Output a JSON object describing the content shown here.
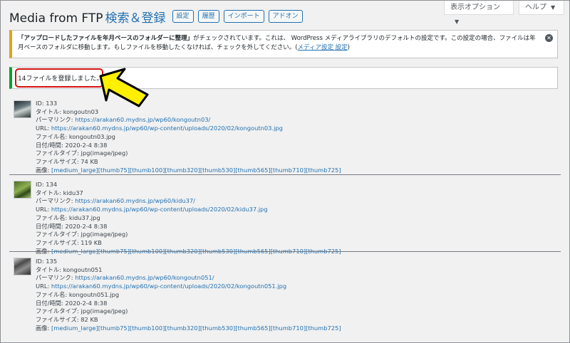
{
  "header": {
    "screen_options": "表示オプション",
    "help": "ヘルプ",
    "title_main": "Media from FTP",
    "title_sub": "検索＆登録",
    "buttons": [
      "設定",
      "履歴",
      "インポート",
      "アドオン"
    ]
  },
  "warning_notice": {
    "bold": "「アップロードしたファイルを年月ベースのフォルダーに整理」",
    "text": "がチェックされています。これは、 WordPress メディアライブラリのデフォルトの設定です。この設定の場合、ファイルは年月ベースのフォルダに移動します。もしファイルを移動したくなければ、チェックを外してください。(",
    "link": "メディア設定",
    "link_tail": " 設定",
    "close_paren": ")",
    "dismiss": "✕"
  },
  "success_notice": {
    "text": "14ファイルを登録しました。"
  },
  "annotation": {
    "box_color": "#d31111",
    "arrow_fill": "#ffef00",
    "arrow_stroke": "#000000"
  },
  "labels": {
    "id": "ID: ",
    "title": "タイトル: ",
    "permalink": "パーマリンク: ",
    "url": "URL: ",
    "filename": "ファイル名: ",
    "datetime": "日付/時間: ",
    "filetype": "ファイルタイプ: ",
    "filesize": "ファイルサイズ: ",
    "images": "画像: "
  },
  "entries": [
    {
      "id": "133",
      "title": "kongoutn03",
      "permalink": "https://arakan60.mydns.jp/wp60/kongoutn03/",
      "url": "https://arakan60.mydns.jp/wp60/wp-content/uploads/2020/02/kongoutn03.jpg",
      "filename": "kongoutn03.jpg",
      "datetime": "2020-2-4 8:38",
      "filetype": "jpg(image/jpeg)",
      "filesize": "74 KB",
      "images": [
        "[medium_large]",
        "[thumb75]",
        "[thumb100]",
        "[thumb320]",
        "[thumb530]",
        "[thumb565]",
        "[thumb710]",
        "[thumb725]"
      ]
    },
    {
      "id": "134",
      "title": "kidu37",
      "permalink": "https://arakan60.mydns.jp/wp60/kidu37/",
      "url": "https://arakan60.mydns.jp/wp60/wp-content/uploads/2020/02/kidu37.jpg",
      "filename": "kidu37.jpg",
      "datetime": "2020-2-4 8:38",
      "filetype": "jpg(image/jpeg)",
      "filesize": "119 KB",
      "images": [
        "[medium_large]",
        "[thumb75]",
        "[thumb100]",
        "[thumb320]",
        "[thumb530]",
        "[thumb565]",
        "[thumb710]",
        "[thumb725]"
      ]
    },
    {
      "id": "135",
      "title": "kongoutn051",
      "permalink": "https://arakan60.mydns.jp/wp60/kongoutn051/",
      "url": "https://arakan60.mydns.jp/wp60/wp-content/uploads/2020/02/kongoutn051.jpg",
      "filename": "kongoutn051.jpg",
      "datetime": "2020-2-4 8:38",
      "filetype": "jpg(image/jpeg)",
      "filesize": "82 KB",
      "images": [
        "[medium_large]",
        "[thumb75]",
        "[thumb100]",
        "[thumb320]",
        "[thumb530]",
        "[thumb565]",
        "[thumb710]",
        "[thumb725]"
      ]
    }
  ]
}
